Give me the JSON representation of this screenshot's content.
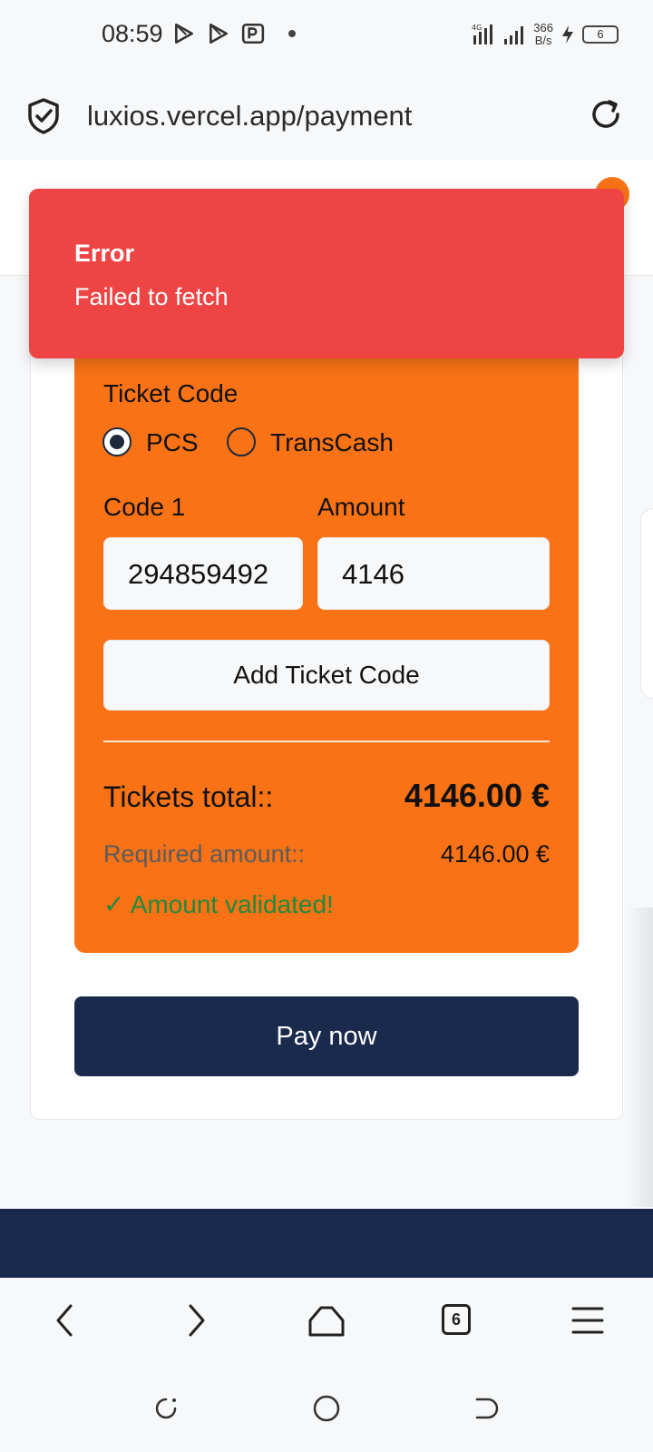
{
  "status_bar": {
    "time": "08:59",
    "net_speed_value": "366",
    "net_speed_unit": "B/s",
    "network": "4G",
    "battery": "6"
  },
  "browser": {
    "url": "luxios.vercel.app/payment",
    "tabs_count": "6"
  },
  "toast": {
    "title": "Error",
    "message": "Failed to fetch",
    "color": "#ef4444"
  },
  "ticket_form": {
    "section_label": "Ticket Code",
    "radio_options": [
      {
        "label": "PCS",
        "checked": true
      },
      {
        "label": "TransCash",
        "checked": false
      }
    ],
    "code_label": "Code 1",
    "amount_label": "Amount",
    "code_value": "294859492",
    "amount_value": "4146",
    "add_button": "Add Ticket Code",
    "tickets_total_label": "Tickets total::",
    "tickets_total_value": "4146.00 €",
    "required_label": "Required amount::",
    "required_value": "4146.00 €",
    "validated_check": "✓",
    "validated_text": "Amount validated!",
    "accent_color": "#f97316"
  },
  "pay_button": {
    "label": "Pay now",
    "color": "#1a2a4d"
  },
  "icons": {
    "url_shield": "shield-check-icon",
    "reload": "reload-icon",
    "back": "back-arrow-icon",
    "forward": "forward-arrow-icon",
    "home": "home-icon",
    "tabs": "tabs-icon",
    "menu": "menu-icon"
  }
}
